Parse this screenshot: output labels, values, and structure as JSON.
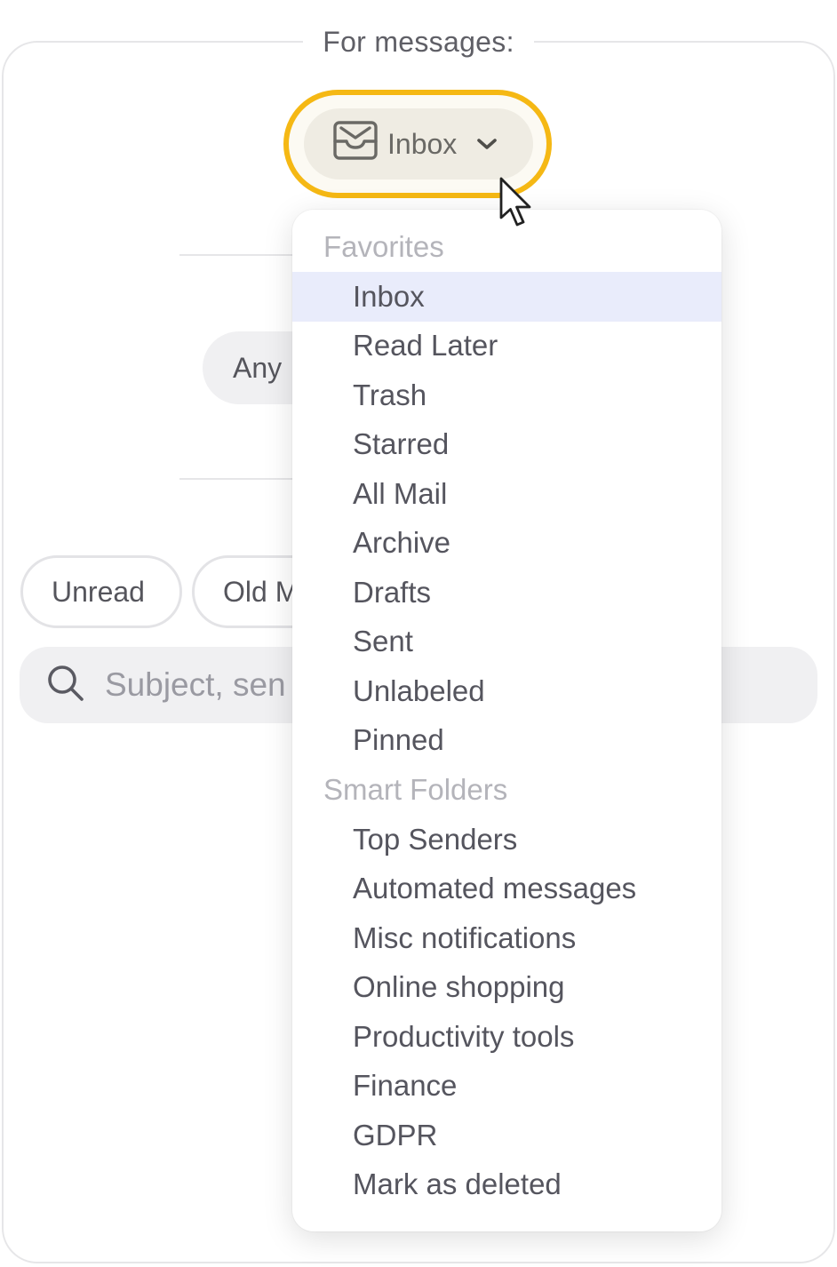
{
  "section": {
    "title": "For messages:"
  },
  "folder_button": {
    "label": "Inbox",
    "accent_color": "#f5b814"
  },
  "any_pill": {
    "label": "Any"
  },
  "chips": {
    "unread": "Unread",
    "old": "Old M"
  },
  "search": {
    "placeholder": "Subject, sen"
  },
  "dropdown": {
    "favorites_header": "Favorites",
    "favorites": [
      "Inbox",
      "Read Later",
      "Trash",
      "Starred",
      "All Mail",
      "Archive",
      "Drafts",
      "Sent",
      "Unlabeled",
      "Pinned"
    ],
    "selected_item": "Inbox",
    "smart_header": "Smart Folders",
    "smart_folders": [
      "Top Senders",
      "Automated messages",
      "Misc notifications",
      "Online shopping",
      "Productivity tools",
      "Finance",
      "GDPR",
      "Mark as deleted"
    ]
  }
}
